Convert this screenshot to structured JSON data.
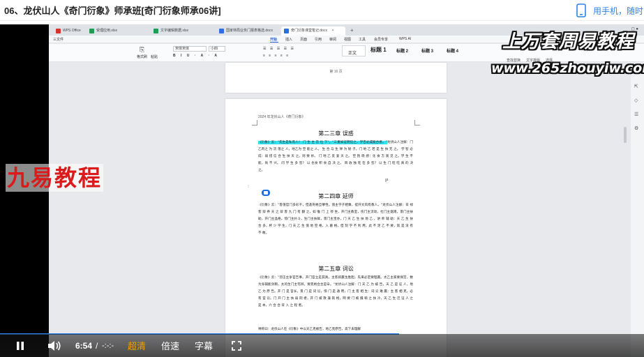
{
  "header": {
    "title": "06、龙伏山人《奇门衍象》师承班[奇门衍象师承06讲]",
    "mobile_text": "用手机，随时"
  },
  "wps": {
    "tabs": [
      {
        "label": "WPS Office",
        "color": "#d8322a"
      },
      {
        "label": "受理应用.xlsx",
        "color": "#1f9d55"
      },
      {
        "label": "文字编辑数据.xlsx",
        "color": "#1f9d55"
      },
      {
        "label": "国家林局业务门报表格选.docx",
        "color": "#2b6fe0"
      },
      {
        "label": "奇门衍象课堂笔记.docx",
        "color": "#2b6fe0"
      }
    ],
    "menu": [
      "三文件",
      "开始",
      "插入",
      "页面",
      "引用",
      "审阅",
      "视图",
      "工具",
      "会员专享",
      "WPS AI"
    ],
    "active_menu": "开始",
    "ribbon": {
      "paste": "格式刷",
      "paste2": "粘贴",
      "font_name": "宋体宋体",
      "font_size": "小四",
      "styles": [
        "正文",
        "标题 1",
        "标题 2",
        "标题 3",
        "标题 4"
      ],
      "right_a": "查找替换",
      "right_b": "文字排版",
      "right_c": "选择"
    },
    "page_number": "第 16 页"
  },
  "document": {
    "header_note": "2024 年龙伏山人《奇门衍象》",
    "chapters": [
      {
        "title": "第二三章 误惑",
        "highlight": "《衍象》云：\"先生是私有人！ 门 生 主 宫 位 下\"，\"三重如证明见之，学否必成能合者。\"",
        "text": "龙伏山人注解：门 乙丙之 为 流 落之 人，地乙为 空 能之 人。 生 合 与 生 禅 为 秘 子。门 地 乙 若 是 生 扶 无 之。 学 智 必 成：弱 措 信 合 生 扶 天 之。则 要 妙。 门 地 乙 反 复 天 之。 空 抱 晓 感：化 食 方 观 见 之。学 生 不 能，尚 不 兴。 问 学 生 多 签？ 以 也食 积 食 自 决 之。 目 收 独 旺 在 多 签？ 以 生 门 旺 旺 真 的 决 之。"
      },
      {
        "title": "第二四章 延师",
        "text": "《衍象》云：\"客值官门多彩干，但逢刑格旦孽性。值主学子相乘，提开文风有教人。\"龙伏山人注解：日 禄 客 辩 养 天 之 辩 客 九 门 有 翻 之，如 惟 门 上 停 坐，开门主教室，伤门主流动，杜门主烟淹，景门主扶助，开门主晶格。惊门主扑斗，生门主扶鲜，景门主宝亦，门 天 乙 生 扶 地 乙 ，讲 师 辅 助：天 乙 生 扶 合 多，杯 少 学 生，门 天 乙 生 值 地 空 格，入 墓 格，但 刻 学 不 利 用，此 不 足 乙 不 要，就 是 没 有 不 敢。"
      },
      {
        "title": "第二五章 词讼",
        "text": "《衍象》云：\"羽壬主争官吉事，开门官立是其真。主客叙赢生胜胆，先来必定要理赢。太乙主家要保宫，数为身辅能剑鞘，太的生门主宅辨，要克格合主是辛。\"龙伏山人注解：门 天 乙 为 被 告，天 乙 是 证 人，地 乙 为 原 告。开 门 是 官长，景 门 是 词 讼，惊 门 是 通 用，门 主 客 相 生：词 讼 难 赢：主 客 相 克，必 有 官 讼。门 开 门 主 扶 弱 刑 者，开 门 被 救 兼 就 格，网 要 门 被 摄 喻 之 扶 冷，天 乙 生 泛 证 人 之 是 本，六 合 合 背 入 之 程 者。",
        "tail": "禅师曰：龙伏山人在《衍象》中以天乙克被告，地乙克原告，高下未理解"
      }
    ],
    "cursor": "I²"
  },
  "overlay": {
    "brand": "九易教程",
    "logo_line1": "上万套周易教程",
    "logo_line2": "www.265zhouyiw.com"
  },
  "player": {
    "current_time": "6:54",
    "separator": "/",
    "duration": "-:-:-",
    "quality": "超清",
    "speed": "倍速",
    "subtitle": "字幕",
    "progress": 0.62
  }
}
